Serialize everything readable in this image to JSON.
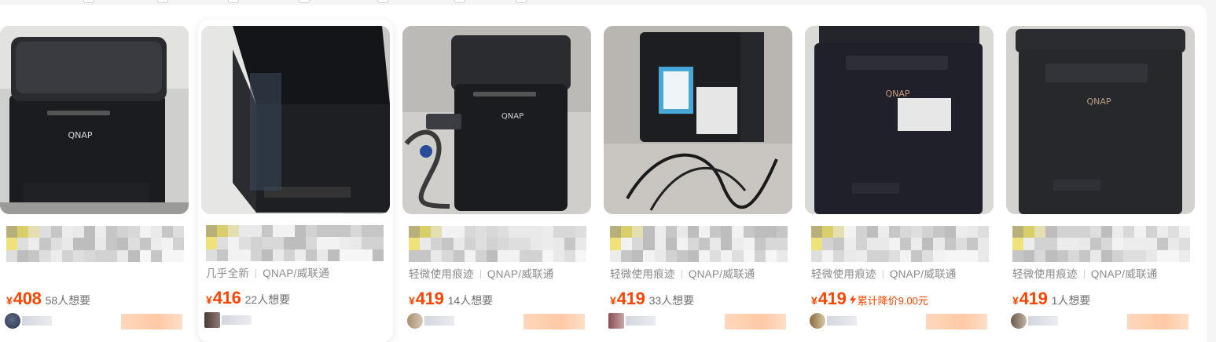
{
  "products": [
    {
      "price_symbol": "¥",
      "price": "408",
      "want": "58人想要",
      "meta": "",
      "price_drop": "",
      "icon": "nas-device-photo"
    },
    {
      "price_symbol": "¥",
      "price": "416",
      "want": "22人想要",
      "meta_a": "几乎全新",
      "meta_b": "QNAP/威联通",
      "price_drop": "",
      "icon": "nas-device-photo"
    },
    {
      "price_symbol": "¥",
      "price": "419",
      "want": "14人想要",
      "meta_a": "轻微使用痕迹",
      "meta_b": "QNAP/威联通",
      "price_drop": "",
      "icon": "nas-device-photo"
    },
    {
      "price_symbol": "¥",
      "price": "419",
      "want": "33人想要",
      "meta_a": "轻微使用痕迹",
      "meta_b": "QNAP/威联通",
      "price_drop": "",
      "icon": "nas-device-photo"
    },
    {
      "price_symbol": "¥",
      "price": "419",
      "want": "",
      "meta_a": "轻微使用痕迹",
      "meta_b": "QNAP/威联通",
      "price_drop": "累计降价9.00元",
      "icon": "nas-device-photo"
    },
    {
      "price_symbol": "¥",
      "price": "419",
      "want": "1人想要",
      "meta_a": "轻微使用痕迹",
      "meta_b": "QNAP/威联通",
      "price_drop": "",
      "icon": "nas-device-photo"
    }
  ],
  "brand_mark": "QNAP",
  "colors": {
    "price": "#ff4400",
    "muted": "#8a8a8a",
    "want": "#6f6f6f"
  }
}
